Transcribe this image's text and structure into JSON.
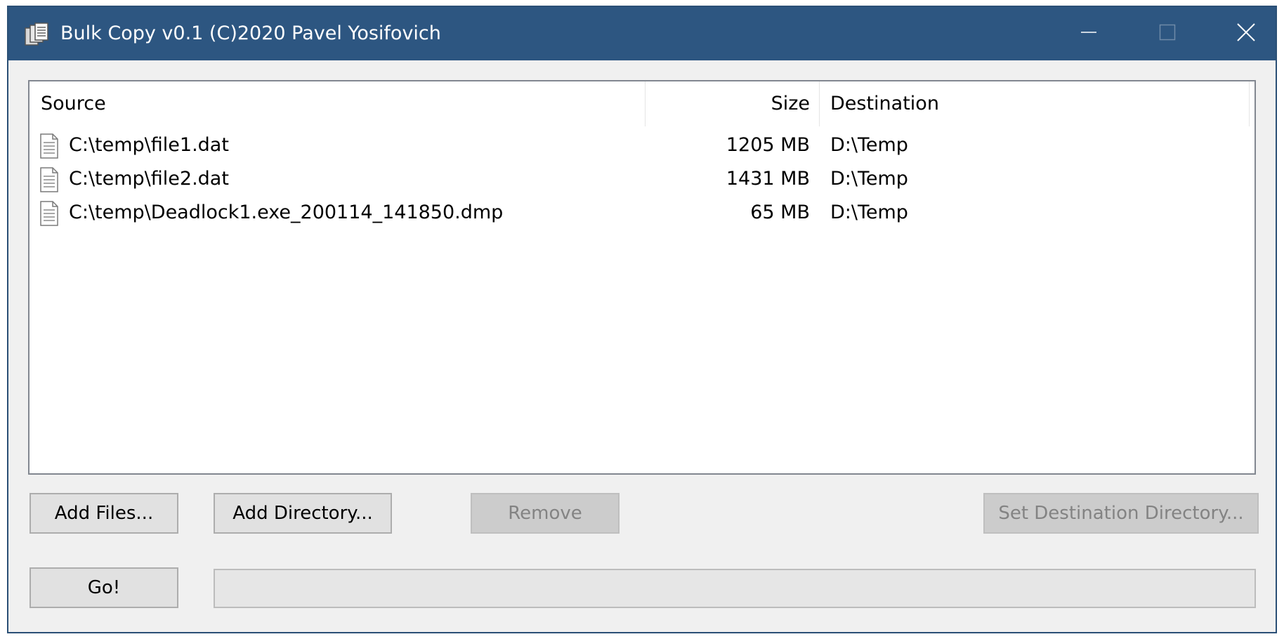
{
  "window": {
    "title": "Bulk Copy v0.1 (C)2020 Pavel Yosifovich",
    "icon": "copy-files-icon",
    "controls": {
      "minimize_icon": "minimize-icon",
      "maximize_icon": "maximize-icon",
      "close_icon": "close-icon"
    }
  },
  "list": {
    "columns": {
      "source": "Source",
      "size": "Size",
      "destination": "Destination"
    },
    "rows": [
      {
        "source": "C:\\temp\\file1.dat",
        "size": "1205 MB",
        "destination": "D:\\Temp",
        "icon": "file-icon"
      },
      {
        "source": "C:\\temp\\file2.dat",
        "size": "1431 MB",
        "destination": "D:\\Temp",
        "icon": "file-icon"
      },
      {
        "source": "C:\\temp\\Deadlock1.exe_200114_141850.dmp",
        "size": "65 MB",
        "destination": "D:\\Temp",
        "icon": "file-icon"
      }
    ]
  },
  "buttons": {
    "add_files": "Add Files...",
    "add_directory": "Add Directory...",
    "remove": "Remove",
    "set_destination": "Set Destination Directory...",
    "go": "Go!"
  },
  "progress": {
    "value": 0
  },
  "colors": {
    "titlebar": "#2d5681",
    "window_bg": "#f0f0f0",
    "disabled_text": "#838383"
  }
}
